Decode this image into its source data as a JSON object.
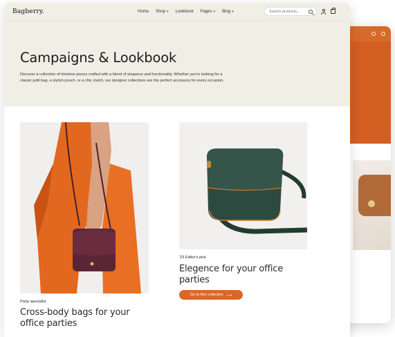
{
  "brand": {
    "logo": "Bagberry.",
    "accent": "#d9672a"
  },
  "nav": {
    "items": [
      {
        "label": "Home",
        "has_menu": false
      },
      {
        "label": "Shop",
        "has_menu": true
      },
      {
        "label": "Lookbook",
        "has_menu": false
      },
      {
        "label": "Pages",
        "has_menu": true
      },
      {
        "label": "Blog",
        "has_menu": true
      }
    ],
    "search_placeholder": "Search products...",
    "icons": [
      "search-icon",
      "user-icon",
      "bag-icon"
    ]
  },
  "hero": {
    "title": "Campaigns & Lookbook",
    "description": "Discover a collection of timeless pieces crafted with a blend of elegance and functionality. Whether you're looking for a classic potli bag, a stylish pouch, or a chic clutch, our designer collections are the perfect accessory for every occasion."
  },
  "cards": [
    {
      "tag": "Party specialist",
      "title": "Cross-body bags for your office parties"
    },
    {
      "tag": "'23 Editor's pick",
      "title": "Elegence for your office parties",
      "cta": "Go to this collection"
    }
  ]
}
